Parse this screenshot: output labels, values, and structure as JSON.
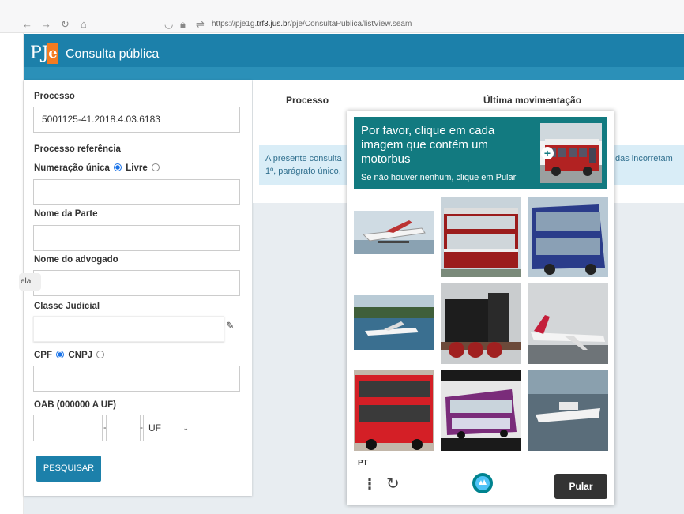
{
  "browser": {
    "url_prefix": "https://pje1g.",
    "url_domain": "trf3.jus.br",
    "url_path": "/pje/ConsultaPublica/listView.seam"
  },
  "header": {
    "logo_pj": "PJ",
    "logo_e": "e",
    "title": "Consulta pública",
    "color": "#1c80aa"
  },
  "search": {
    "processo_label": "Processo",
    "processo_value": "5001125-41.2018.4.03.6183",
    "referencia_label": "Processo referência",
    "numeracao_label": "Numeração única",
    "livre_label": "Livre",
    "parte_label": "Nome da Parte",
    "advogado_label": "Nome do advogado",
    "side_tag": "ela",
    "classe_label": "Classe Judicial",
    "cpf_label": "CPF",
    "cnpj_label": "CNPJ",
    "oab_label": "OAB (000000 A UF)",
    "dash": "-",
    "uf_value": "UF",
    "search_button": "PESQUISAR"
  },
  "results": {
    "col_processo": "Processo",
    "col_ultima": "Última movimentação",
    "info_line1": "A presente consulta",
    "info_line2": "1º, parágrafo único,",
    "info_right": "das incorretam"
  },
  "captcha": {
    "title": "Por favor, clique em cada imagem que contém um motorbus",
    "subtitle": "Se não houver nenhum, clique em Pular",
    "language": "PT",
    "skip_button": "Pular",
    "header_color": "#127a80"
  }
}
